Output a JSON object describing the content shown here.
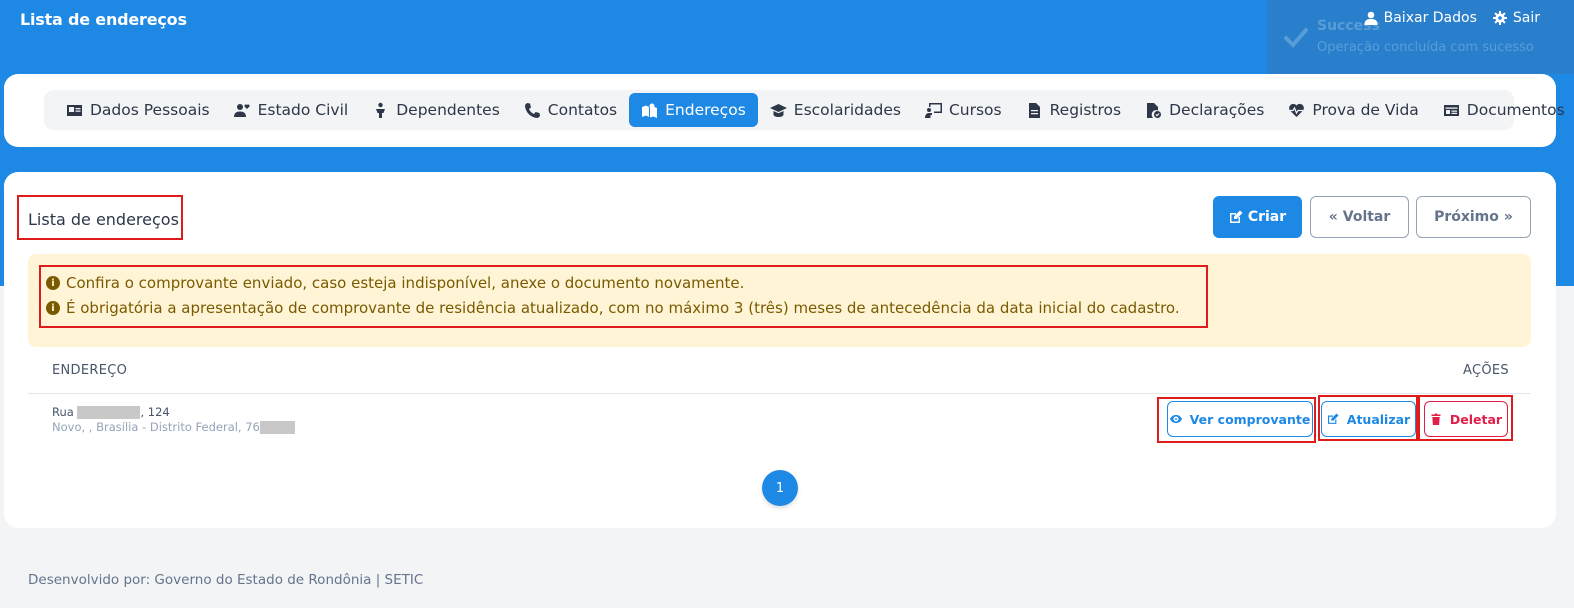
{
  "header": {
    "app_title": "Lista de endereços",
    "download_label": "Baixar Dados",
    "logout_label": "Sair"
  },
  "toast": {
    "title": "Success",
    "message": "Operação concluída com sucesso"
  },
  "tabs": [
    {
      "label": "Dados Pessoais",
      "icon": "id-card-icon"
    },
    {
      "label": "Estado Civil",
      "icon": "user-heart-icon"
    },
    {
      "label": "Dependentes",
      "icon": "child-icon"
    },
    {
      "label": "Contatos",
      "icon": "phone-icon"
    },
    {
      "label": "Endereços",
      "icon": "map-location-icon",
      "active": true
    },
    {
      "label": "Escolaridades",
      "icon": "graduation-cap-icon"
    },
    {
      "label": "Cursos",
      "icon": "chalkboard-teacher-icon"
    },
    {
      "label": "Registros",
      "icon": "file-icon"
    },
    {
      "label": "Declarações",
      "icon": "file-check-icon"
    },
    {
      "label": "Prova de Vida",
      "icon": "heartbeat-icon"
    },
    {
      "label": "Documentos",
      "icon": "address-card-icon"
    }
  ],
  "main": {
    "title": "Lista de endereços",
    "create_label": "Criar",
    "back_label": "Voltar",
    "next_label": "Próximo",
    "alerts": [
      "Confira o comprovante enviado, caso esteja indisponível, anexe o documento novamente.",
      "É obrigatória a apresentação de comprovante de residência atualizado, com no máximo 3 (três) meses de antecedência da data inicial do cadastro."
    ],
    "table": {
      "col_address": "ENDEREÇO",
      "col_actions": "AÇÕES",
      "rows": [
        {
          "street_prefix": "Rua",
          "street_number": ", 124",
          "line2_prefix": "Novo, , Brasília - Distrito Federal, 76"
        }
      ],
      "view_label": "Ver comprovante",
      "update_label": "Atualizar",
      "delete_label": "Deletar"
    },
    "pagination": {
      "current": "1"
    }
  },
  "footer": {
    "text": "Desenvolvido por: Governo do Estado de Rondônia | SETIC"
  },
  "colors": {
    "primary": "#1e88e5",
    "alert_bg": "#fff4d6",
    "alert_text": "#7a5a00",
    "danger": "#e11d48",
    "highlight": "#e01b1b"
  }
}
